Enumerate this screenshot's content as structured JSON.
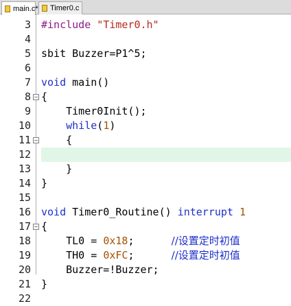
{
  "tabs": [
    {
      "label": "main.c*",
      "active": true
    },
    {
      "label": "Timer0.c",
      "active": false
    }
  ],
  "editor": {
    "current_line": "12",
    "lines": [
      {
        "num": "3",
        "fold": "",
        "tokens": [
          {
            "t": "dir",
            "v": "#include"
          },
          {
            "t": "plain",
            "v": " "
          },
          {
            "t": "str",
            "v": "\"Timer0.h\""
          }
        ]
      },
      {
        "num": "4",
        "fold": "",
        "tokens": []
      },
      {
        "num": "5",
        "fold": "",
        "tokens": [
          {
            "t": "plain",
            "v": "sbit Buzzer=P1^5;"
          }
        ]
      },
      {
        "num": "6",
        "fold": "",
        "tokens": []
      },
      {
        "num": "7",
        "fold": "",
        "tokens": [
          {
            "t": "kw",
            "v": "void"
          },
          {
            "t": "plain",
            "v": " main()"
          }
        ]
      },
      {
        "num": "8",
        "fold": "-",
        "tokens": [
          {
            "t": "plain",
            "v": "{"
          }
        ]
      },
      {
        "num": "9",
        "fold": "",
        "tokens": [
          {
            "t": "plain",
            "v": "    Timer0Init();"
          }
        ]
      },
      {
        "num": "10",
        "fold": "",
        "tokens": [
          {
            "t": "plain",
            "v": "    "
          },
          {
            "t": "kw",
            "v": "while"
          },
          {
            "t": "plain",
            "v": "("
          },
          {
            "t": "num",
            "v": "1"
          },
          {
            "t": "plain",
            "v": ")"
          }
        ]
      },
      {
        "num": "11",
        "fold": "-",
        "tokens": [
          {
            "t": "plain",
            "v": "    {"
          }
        ]
      },
      {
        "num": "12",
        "fold": "",
        "tokens": []
      },
      {
        "num": "13",
        "fold": "",
        "tokens": [
          {
            "t": "plain",
            "v": "    }"
          }
        ]
      },
      {
        "num": "14",
        "fold": "",
        "tokens": [
          {
            "t": "plain",
            "v": "}"
          }
        ]
      },
      {
        "num": "15",
        "fold": "",
        "tokens": []
      },
      {
        "num": "16",
        "fold": "",
        "tokens": [
          {
            "t": "kw",
            "v": "void"
          },
          {
            "t": "plain",
            "v": " Timer0_Routine() "
          },
          {
            "t": "kw",
            "v": "interrupt"
          },
          {
            "t": "plain",
            "v": " "
          },
          {
            "t": "num",
            "v": "1"
          }
        ]
      },
      {
        "num": "17",
        "fold": "-",
        "tokens": [
          {
            "t": "plain",
            "v": "{"
          }
        ]
      },
      {
        "num": "18",
        "fold": "",
        "tokens": [
          {
            "t": "plain",
            "v": "    TL0 = "
          },
          {
            "t": "num",
            "v": "0x18"
          },
          {
            "t": "plain",
            "v": ";      "
          },
          {
            "t": "com",
            "v": "//设置定时初值"
          }
        ]
      },
      {
        "num": "19",
        "fold": "",
        "tokens": [
          {
            "t": "plain",
            "v": "    TH0 = "
          },
          {
            "t": "num",
            "v": "0xFC"
          },
          {
            "t": "plain",
            "v": ";      "
          },
          {
            "t": "com",
            "v": "//设置定时初值"
          }
        ]
      },
      {
        "num": "20",
        "fold": "",
        "tokens": [
          {
            "t": "plain",
            "v": "    Buzzer=!Buzzer;"
          }
        ]
      },
      {
        "num": "21",
        "fold": "",
        "tokens": [
          {
            "t": "plain",
            "v": "}"
          }
        ]
      },
      {
        "num": "22",
        "fold": "",
        "tokens": []
      }
    ]
  }
}
